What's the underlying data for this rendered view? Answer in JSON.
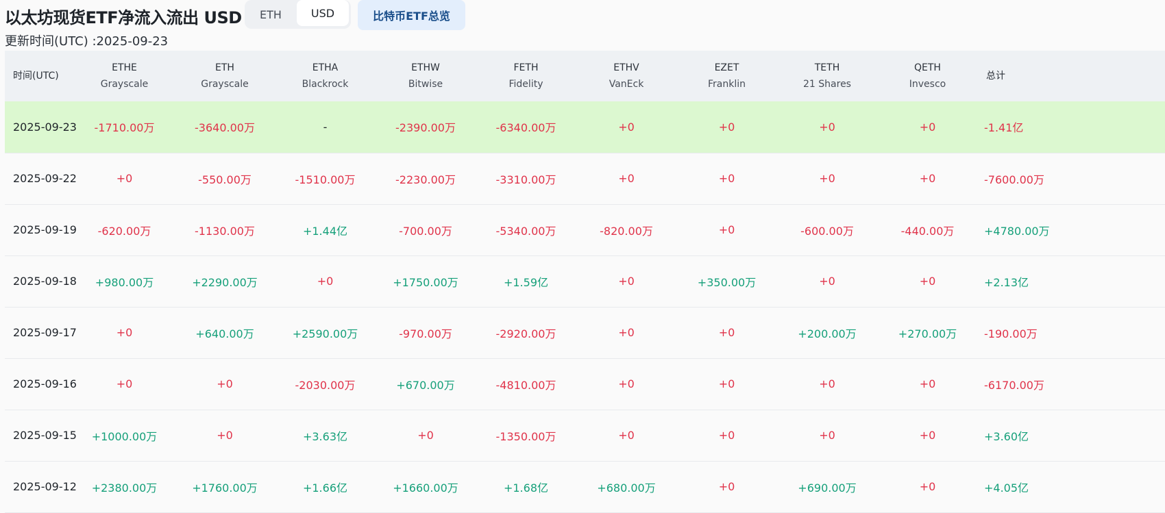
{
  "title": "以太坊现货ETF净流入流出 USD",
  "toggle": {
    "eth_label": "ETH",
    "usd_label": "USD",
    "selected": "USD"
  },
  "btc_overview_label": "比特币ETF总览",
  "updated": "更新时间(UTC) :2025-09-23",
  "colors": {
    "negative": "#e0334a",
    "positive": "#16a07a",
    "highlight_row": "#dcf8d0",
    "header_bg": "#eef1f4"
  },
  "table": {
    "columns": [
      {
        "ticker": "时间(UTC)",
        "issuer": ""
      },
      {
        "ticker": "ETHE",
        "issuer": "Grayscale"
      },
      {
        "ticker": "ETH",
        "issuer": "Grayscale"
      },
      {
        "ticker": "ETHA",
        "issuer": "Blackrock"
      },
      {
        "ticker": "ETHW",
        "issuer": "Bitwise"
      },
      {
        "ticker": "FETH",
        "issuer": "Fidelity"
      },
      {
        "ticker": "ETHV",
        "issuer": "VanEck"
      },
      {
        "ticker": "EZET",
        "issuer": "Franklin"
      },
      {
        "ticker": "TETH",
        "issuer": "21 Shares"
      },
      {
        "ticker": "QETH",
        "issuer": "Invesco"
      },
      {
        "ticker": "总计",
        "issuer": ""
      }
    ],
    "rows": [
      {
        "date": "2025-09-23",
        "cells": [
          "-1710.00万",
          "-3640.00万",
          "-",
          "-2390.00万",
          "-6340.00万",
          "+0",
          "+0",
          "+0",
          "+0"
        ],
        "total": "-1.41亿"
      },
      {
        "date": "2025-09-22",
        "cells": [
          "+0",
          "-550.00万",
          "-1510.00万",
          "-2230.00万",
          "-3310.00万",
          "+0",
          "+0",
          "+0",
          "+0"
        ],
        "total": "-7600.00万"
      },
      {
        "date": "2025-09-19",
        "cells": [
          "-620.00万",
          "-1130.00万",
          "+1.44亿",
          "-700.00万",
          "-5340.00万",
          "-820.00万",
          "+0",
          "-600.00万",
          "-440.00万"
        ],
        "total": "+4780.00万"
      },
      {
        "date": "2025-09-18",
        "cells": [
          "+980.00万",
          "+2290.00万",
          "+0",
          "+1750.00万",
          "+1.59亿",
          "+0",
          "+350.00万",
          "+0",
          "+0"
        ],
        "total": "+2.13亿"
      },
      {
        "date": "2025-09-17",
        "cells": [
          "+0",
          "+640.00万",
          "+2590.00万",
          "-970.00万",
          "-2920.00万",
          "+0",
          "+0",
          "+200.00万",
          "+270.00万"
        ],
        "total": "-190.00万"
      },
      {
        "date": "2025-09-16",
        "cells": [
          "+0",
          "+0",
          "-2030.00万",
          "+670.00万",
          "-4810.00万",
          "+0",
          "+0",
          "+0",
          "+0"
        ],
        "total": "-6170.00万"
      },
      {
        "date": "2025-09-15",
        "cells": [
          "+1000.00万",
          "+0",
          "+3.63亿",
          "+0",
          "-1350.00万",
          "+0",
          "+0",
          "+0",
          "+0"
        ],
        "total": "+3.60亿"
      },
      {
        "date": "2025-09-12",
        "cells": [
          "+2380.00万",
          "+1760.00万",
          "+1.66亿",
          "+1660.00万",
          "+1.68亿",
          "+680.00万",
          "+0",
          "+690.00万",
          "+0"
        ],
        "total": "+4.05亿"
      }
    ]
  }
}
